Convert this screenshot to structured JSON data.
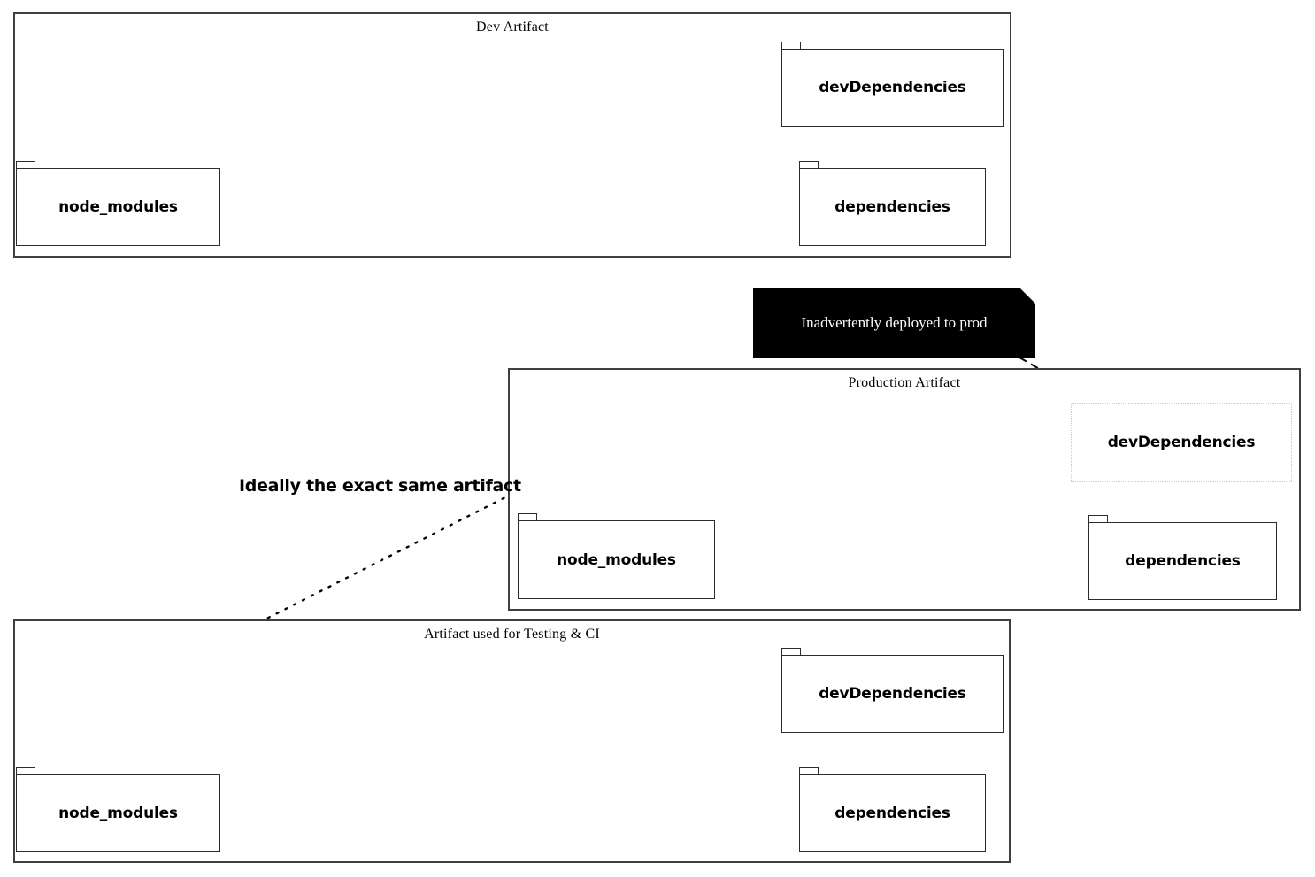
{
  "diagram": {
    "title": "node_modules dev vs production artifact diagram",
    "background": "#ffffff",
    "line_color": "#000000",
    "frame_border_color": "#3d4043",
    "note_background": "#000000",
    "note_text_color": "#ffffff",
    "ghost_border_color": "#c9c9c9"
  },
  "frames": [
    {
      "id": "dev",
      "title": "Dev Artifact",
      "packages": [
        {
          "id": "dev-node-modules",
          "label": "node_modules",
          "style": "solid"
        },
        {
          "id": "dev-devdependencies",
          "label": "devDependencies",
          "style": "solid"
        },
        {
          "id": "dev-dependencies",
          "label": "dependencies",
          "style": "solid"
        }
      ]
    },
    {
      "id": "production",
      "title": "Production Artifact",
      "packages": [
        {
          "id": "prod-node-modules",
          "label": "node_modules",
          "style": "solid"
        },
        {
          "id": "prod-devdependencies",
          "label": "devDependencies",
          "style": "dotted"
        },
        {
          "id": "prod-dependencies",
          "label": "dependencies",
          "style": "solid"
        }
      ]
    },
    {
      "id": "testing",
      "title": "Artifact used for Testing & CI",
      "packages": [
        {
          "id": "test-node-modules",
          "label": "node_modules",
          "style": "solid"
        },
        {
          "id": "test-devdependencies",
          "label": "devDependencies",
          "style": "solid"
        },
        {
          "id": "test-dependencies",
          "label": "dependencies",
          "style": "solid"
        }
      ]
    }
  ],
  "note": {
    "id": "deployed-note",
    "text": "Inadvertently deployed to prod",
    "points_to": "prod-devdependencies",
    "connector": "dashed-arrow"
  },
  "annotations": [
    {
      "id": "same-artifact-label",
      "text": "Ideally the exact same artifact",
      "connector": "dotted-double-arrow",
      "connects": [
        "production",
        "testing"
      ]
    }
  ],
  "edges": [
    {
      "from": "dev-node-modules",
      "to": "dev-devdependencies",
      "style": "solid-arrow"
    },
    {
      "from": "dev-node-modules",
      "to": "dev-dependencies",
      "style": "solid-arrow"
    },
    {
      "from": "prod-node-modules",
      "to": "prod-devdependencies",
      "style": "solid-arrow"
    },
    {
      "from": "prod-node-modules",
      "to": "prod-dependencies",
      "style": "solid-arrow"
    },
    {
      "from": "test-node-modules",
      "to": "test-devdependencies",
      "style": "solid-arrow"
    },
    {
      "from": "test-node-modules",
      "to": "test-dependencies",
      "style": "solid-arrow"
    }
  ]
}
